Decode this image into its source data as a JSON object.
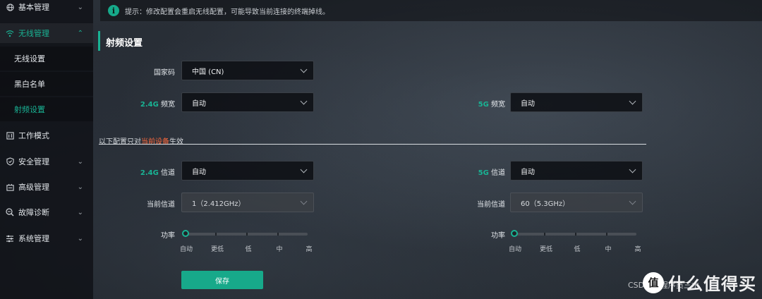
{
  "sidebar": {
    "items": [
      {
        "label": "基本管理",
        "icon": "globe-icon",
        "chevron": "⌄"
      },
      {
        "label": "无线管理",
        "icon": "wifi-icon",
        "chevron": "⌃"
      },
      {
        "label": "工作模式",
        "icon": "work-mode-icon"
      },
      {
        "label": "安全管理",
        "icon": "shield-icon",
        "chevron": "⌄"
      },
      {
        "label": "高级管理",
        "icon": "advanced-icon",
        "chevron": "⌄"
      },
      {
        "label": "故障诊断",
        "icon": "diagnose-icon",
        "chevron": "⌄"
      },
      {
        "label": "系统管理",
        "icon": "system-settings-icon",
        "chevron": "⌄"
      }
    ],
    "sub_items": [
      {
        "label": "无线设置"
      },
      {
        "label": "黑白名单"
      },
      {
        "label": "射频设置"
      }
    ],
    "active_item": "无线管理",
    "active_sub_item": "射频设置"
  },
  "notice": {
    "icon": "info-icon",
    "icon_glyph": "i",
    "text": "提示：修改配置会重启无线配置，可能导致当前连接的终端掉线。"
  },
  "section": {
    "title": "射频设置"
  },
  "form": {
    "country": {
      "label": "国家码",
      "value": "中国 (CN)"
    },
    "bw24": {
      "label_accent": "2.4G",
      "label_text": " 频宽",
      "value": "自动"
    },
    "bw5": {
      "label_accent": "5G",
      "label_text": " 频宽",
      "value": "自动"
    },
    "divider": {
      "prefix": "以下配置只对",
      "highlight": "当前设备",
      "suffix": "生效"
    },
    "ch24": {
      "label_accent": "2.4G",
      "label_text": " 信道",
      "value": "自动"
    },
    "ch5": {
      "label_accent": "5G",
      "label_text": " 信道",
      "value": "自动"
    },
    "cur24": {
      "label": "当前信道",
      "value": "1（2.412GHz）"
    },
    "cur5": {
      "label": "当前信道",
      "value": "60（5.3GHz）"
    },
    "power24": {
      "label": "功率",
      "level": 0,
      "marks": [
        "自动",
        "更低",
        "低",
        "中",
        "高"
      ]
    },
    "power5": {
      "label": "功率",
      "level": 0,
      "marks": [
        "自动",
        "更低",
        "低",
        "中",
        "高"
      ]
    },
    "save_label": "保存"
  },
  "watermark": {
    "logo": "值",
    "text": "什么值得买",
    "csdn": "CSDN @程序员三木"
  },
  "colors": {
    "accent": "#19b394",
    "highlight": "#ff6a3d",
    "button": "#17a98a"
  }
}
